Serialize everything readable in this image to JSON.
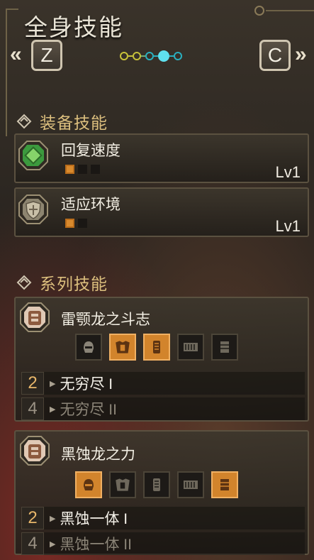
{
  "header": {
    "title": "全身技能",
    "prev_key": "Z",
    "next_key": "C",
    "prev_arrow": "«",
    "next_arrow": "»",
    "page_indicator": {
      "total": 5,
      "current": 4
    }
  },
  "equipment_skills": {
    "section_title": "装备技能",
    "items": [
      {
        "name": "回复速度",
        "level_label": "Lv1",
        "level": 1,
        "max_level": 3,
        "icon": "green-diamond-skill-icon"
      },
      {
        "name": "适应环境",
        "level_label": "Lv1",
        "level": 1,
        "max_level": 2,
        "icon": "shield-cross-skill-icon"
      }
    ]
  },
  "set_skills": {
    "section_title": "系列技能",
    "sets": [
      {
        "name": "雷颚龙之斗志",
        "icon": "armor-set-icon",
        "pieces": [
          false,
          true,
          true,
          false,
          false
        ],
        "piece_icons": [
          "helm-icon",
          "chest-icon",
          "arm-icon",
          "waist-icon",
          "leg-icon"
        ],
        "bonuses": [
          {
            "count": "2",
            "name": "无穷尽 I",
            "active": true
          },
          {
            "count": "4",
            "name": "无穷尽 II",
            "active": false
          }
        ]
      },
      {
        "name": "黑蚀龙之力",
        "icon": "armor-set-icon",
        "pieces": [
          true,
          false,
          false,
          false,
          true
        ],
        "piece_icons": [
          "helm-icon",
          "chest-icon",
          "arm-icon",
          "waist-icon",
          "leg-icon"
        ],
        "bonuses": [
          {
            "count": "2",
            "name": "黑蚀一体 I",
            "active": true
          },
          {
            "count": "4",
            "name": "黑蚀一体 II",
            "active": false
          }
        ]
      }
    ]
  },
  "colors": {
    "accent_gold": "#dcbf7e",
    "pip_active": "#d88a2e",
    "dot_yellow": "#c7c23a",
    "dot_teal": "#2ab0c0"
  }
}
